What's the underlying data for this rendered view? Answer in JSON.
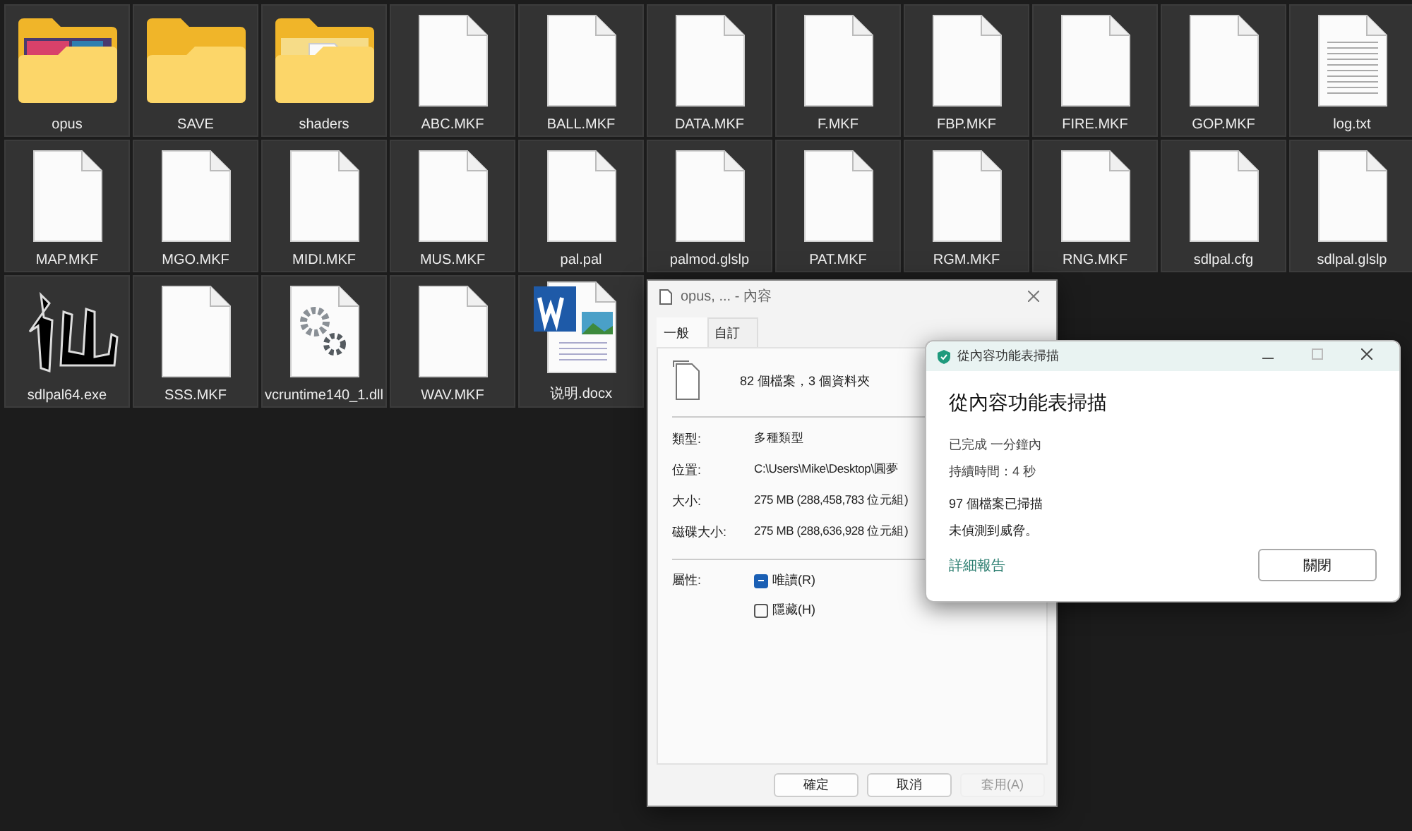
{
  "files": [
    {
      "name": "opus",
      "kind": "folder-image",
      "selected": true
    },
    {
      "name": "SAVE",
      "kind": "folder",
      "selected": true
    },
    {
      "name": "shaders",
      "kind": "folder-file",
      "selected": true
    },
    {
      "name": "ABC.MKF",
      "kind": "file",
      "selected": true
    },
    {
      "name": "BALL.MKF",
      "kind": "file",
      "selected": true
    },
    {
      "name": "DATA.MKF",
      "kind": "file",
      "selected": true
    },
    {
      "name": "F.MKF",
      "kind": "file",
      "selected": true
    },
    {
      "name": "FBP.MKF",
      "kind": "file",
      "selected": true
    },
    {
      "name": "FIRE.MKF",
      "kind": "file",
      "selected": true
    },
    {
      "name": "GOP.MKF",
      "kind": "file",
      "selected": true
    },
    {
      "name": "log.txt",
      "kind": "text",
      "selected": true
    },
    {
      "name": "MAP.MKF",
      "kind": "file",
      "selected": true
    },
    {
      "name": "MGO.MKF",
      "kind": "file",
      "selected": true
    },
    {
      "name": "MIDI.MKF",
      "kind": "file",
      "selected": true
    },
    {
      "name": "MUS.MKF",
      "kind": "file",
      "selected": true
    },
    {
      "name": "pal.pal",
      "kind": "file",
      "selected": true
    },
    {
      "name": "palmod.glslp",
      "kind": "file",
      "selected": true
    },
    {
      "name": "PAT.MKF",
      "kind": "file",
      "selected": true
    },
    {
      "name": "RGM.MKF",
      "kind": "file",
      "selected": true
    },
    {
      "name": "RNG.MKF",
      "kind": "file",
      "selected": true
    },
    {
      "name": "sdlpal.cfg",
      "kind": "file",
      "selected": true
    },
    {
      "name": "sdlpal.glslp",
      "kind": "file",
      "selected": true
    },
    {
      "name": "sdlpal64.exe",
      "kind": "app",
      "selected": true
    },
    {
      "name": "SSS.MKF",
      "kind": "file",
      "selected": true
    },
    {
      "name": "vcruntime140_1.dll",
      "kind": "dll",
      "selected": true
    },
    {
      "name": "WAV.MKF",
      "kind": "file",
      "selected": true
    },
    {
      "name": "说明.docx",
      "kind": "word",
      "selected": true
    }
  ],
  "properties": {
    "title": "opus, ... - 內容",
    "tabs": [
      {
        "label": "一般",
        "selected": true
      },
      {
        "label": "自訂",
        "selected": false
      }
    ],
    "summary": "82 個檔案，3 個資料夾",
    "fields": [
      {
        "label": "類型:",
        "value": "多種類型"
      },
      {
        "label": "位置:",
        "value": "C:\\Users\\Mike\\Desktop\\圓夢"
      },
      {
        "label": "大小:",
        "value": "275 MB (288,458,783 位元組)"
      },
      {
        "label": "磁碟大小:",
        "value": "275 MB (288,636,928 位元組)"
      }
    ],
    "attributes_label": "屬性:",
    "attributes": [
      {
        "label": "唯讀(R)",
        "checked": true,
        "indeterminate": true
      },
      {
        "label": "隱藏(H)",
        "checked": false,
        "indeterminate": false
      }
    ],
    "buttons": [
      {
        "label": "確定",
        "disabled": false
      },
      {
        "label": "取消",
        "disabled": false
      },
      {
        "label": "套用(A)",
        "disabled": true
      }
    ]
  },
  "scan": {
    "title": "從內容功能表掃描",
    "heading": "從內容功能表掃描",
    "lines": [
      "已完成 一分鐘內",
      "持續時間：4 秒"
    ],
    "lines2": [
      "97 個檔案已掃描",
      "未偵測到威脅。"
    ],
    "link": "詳細報告",
    "button": "關閉"
  }
}
